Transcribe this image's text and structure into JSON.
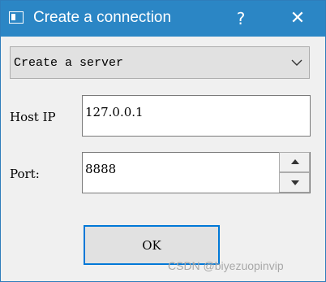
{
  "window": {
    "title": "Create a connection",
    "help_glyph": "?",
    "close_glyph": "✕",
    "title_bar_color": "#2b86c5",
    "focus_color": "#0078d7"
  },
  "mode": {
    "selected": "Create a server"
  },
  "host": {
    "label": "Host IP",
    "value": "127.0.0.1"
  },
  "port": {
    "label": "Port:",
    "value": "8888"
  },
  "actions": {
    "ok_label": "OK"
  },
  "watermark": "CSDN @biyezuopinvip",
  "icons": [
    "app-window-icon",
    "help-icon",
    "close-icon",
    "chevron-down-icon",
    "spin-up-icon",
    "spin-down-icon"
  ]
}
